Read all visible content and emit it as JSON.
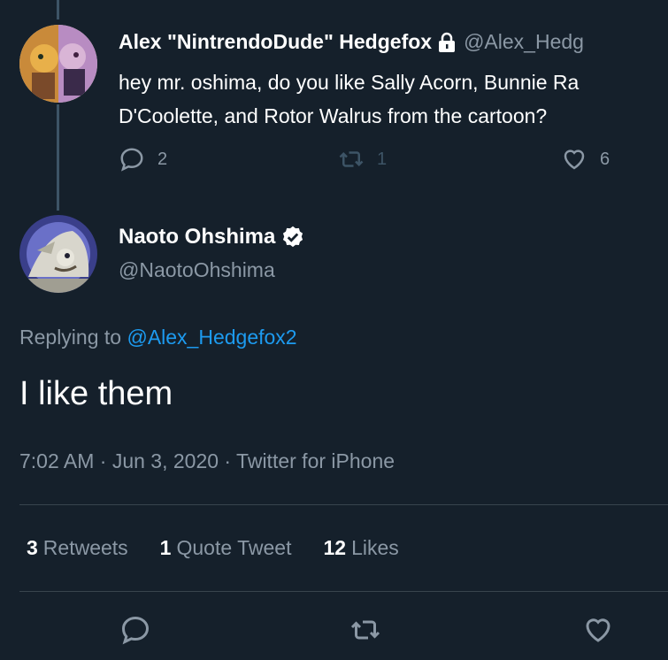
{
  "parent_tweet": {
    "display_name": "Alex \"NintrendoDude\" Hedgefox",
    "handle": "@Alex_Hedg",
    "text_line1": "hey mr. oshima, do you like Sally Acorn, Bunnie Ra",
    "text_line2": "D'Coolette, and Rotor Walrus from the cartoon?",
    "reply_count": "2",
    "retweet_count": "1",
    "like_count": "6"
  },
  "main_tweet": {
    "display_name": "Naoto Ohshima",
    "handle": "@NaotoOhshima",
    "replying_prefix": "Replying to",
    "replying_handle": "@Alex_Hedgefox2",
    "text": "I like them",
    "timestamp": "7:02 AM · Jun 3, 2020 · Twitter for iPhone"
  },
  "stats": {
    "retweets_num": "3",
    "retweets_label": "Retweets",
    "quotes_num": "1",
    "quotes_label": "Quote Tweet",
    "likes_num": "12",
    "likes_label": "Likes"
  },
  "icons": [
    "lock-icon",
    "reply-icon",
    "retweet-icon",
    "like-icon",
    "verified-icon"
  ],
  "colors": {
    "background": "#15202b",
    "secondary_text": "#8b98a5",
    "link": "#1d9bf0",
    "divider": "#38444d"
  }
}
